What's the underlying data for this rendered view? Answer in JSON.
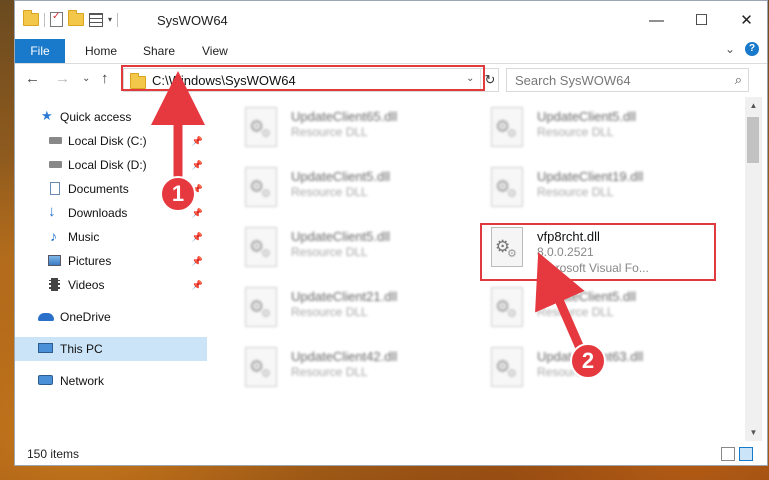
{
  "window": {
    "title": "SysWOW64",
    "controls": {
      "minimize": "—",
      "maximize": "☐",
      "close": "✕"
    }
  },
  "ribbon": {
    "tabs": [
      "File",
      "Home",
      "Share",
      "View"
    ],
    "expand_glyph": "⌄",
    "help_glyph": "?"
  },
  "nav": {
    "back": "←",
    "forward": "→",
    "recent": "⌄",
    "up": "↑",
    "address": "C:\\Windows\\SysWOW64",
    "address_dropdown": "⌄",
    "refresh": "↻",
    "search_placeholder": "Search SysWOW64",
    "search_icon": "⌕"
  },
  "sidebar": {
    "items": [
      {
        "label": "Quick access",
        "icon": "star-icon",
        "pinned": false
      },
      {
        "label": "Local Disk (C:)",
        "icon": "drive-icon",
        "pinned": true
      },
      {
        "label": "Local Disk (D:)",
        "icon": "drive-icon",
        "pinned": true
      },
      {
        "label": "Documents",
        "icon": "documents-icon",
        "pinned": true
      },
      {
        "label": "Downloads",
        "icon": "download-icon",
        "pinned": true
      },
      {
        "label": "Music",
        "icon": "music-icon",
        "pinned": true
      },
      {
        "label": "Pictures",
        "icon": "pictures-icon",
        "pinned": true
      },
      {
        "label": "Videos",
        "icon": "video-icon",
        "pinned": true
      },
      {
        "label": "OneDrive",
        "icon": "cloud-icon",
        "pinned": false
      },
      {
        "label": "This PC",
        "icon": "computer-icon",
        "pinned": false
      },
      {
        "label": "Network",
        "icon": "network-icon",
        "pinned": false
      }
    ],
    "pin_glyph": "📌"
  },
  "files": [
    {
      "name": "UpdateClient65.dll",
      "type": "Resource DLL"
    },
    {
      "name": "UpdateClient5.dll",
      "type": "Resource DLL"
    },
    {
      "name": "UpdateClient5.dll",
      "type": "Resource DLL"
    },
    {
      "name": "UpdateClient19.dll",
      "type": "Resource DLL"
    },
    {
      "name": "UpdateClient5.dll",
      "type": "Resource DLL"
    },
    {
      "name": "vfp8rcht.dll",
      "type": "8.0.0.2521",
      "desc": "Microsoft Visual Fo..."
    },
    {
      "name": "UpdateClient21.dll",
      "type": "Resource DLL"
    },
    {
      "name": "UpdateClient5.dll",
      "type": "Resource DLL"
    },
    {
      "name": "UpdateClient42.dll",
      "type": "Resource DLL"
    },
    {
      "name": "UpdateClient63.dll",
      "type": "Resource..."
    }
  ],
  "status": {
    "item_count": "150 items"
  },
  "annotations": [
    {
      "label": "1"
    },
    {
      "label": "2"
    }
  ],
  "colors": {
    "accent": "#1979ca",
    "highlight_red": "#e0393e",
    "selected_bg": "#cce4f7"
  }
}
